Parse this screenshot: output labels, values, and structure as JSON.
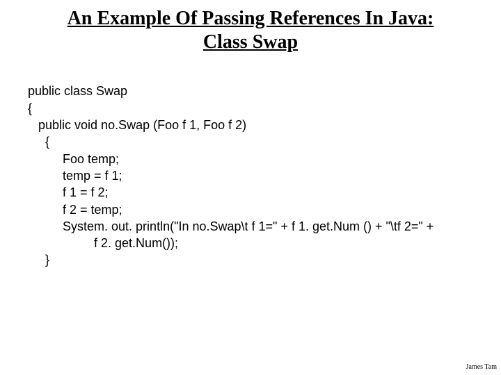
{
  "title_line1": "An Example Of Passing References In Java:",
  "title_line2": "Class Swap",
  "code": {
    "l1": "public class Swap",
    "l2": "{",
    "l3": "   public void no.Swap (Foo f 1, Foo f 2)",
    "l4": "     {",
    "l5": "          Foo temp;",
    "l6": "          temp = f 1;",
    "l7": "          f 1 = f 2;",
    "l8": "          f 2 = temp;",
    "l9": "          System. out. println(\"In no.Swap\\t f 1=\" + f 1. get.Num () + \"\\tf 2=\" +",
    "l10": "                   f 2. get.Num());",
    "l11": "     }"
  },
  "footer": "James Tam"
}
